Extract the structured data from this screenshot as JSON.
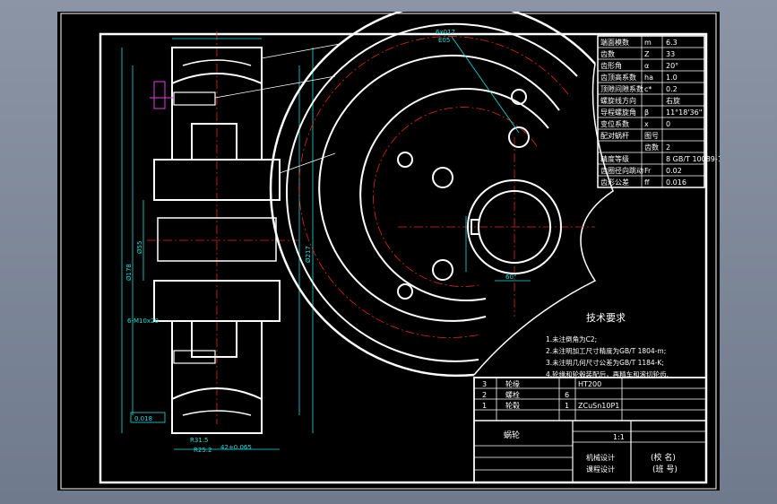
{
  "drawing": {
    "title_label": "蜗轮",
    "scale_value": "1:1",
    "tech_req": {
      "heading": "技术要求",
      "items": [
        "1.未注倒角为C2;",
        "2.未注明加工尺寸精度为GB/T 1804-m;",
        "3.未注明几何尺寸公差为GB/T 1184-K;",
        "4.轮缘和轮毂装配后，再精车和滚切轮齿."
      ]
    },
    "params": [
      {
        "name": "端面模数",
        "sym": "m",
        "val": "6.3"
      },
      {
        "name": "齿数",
        "sym": "Z",
        "val": "33"
      },
      {
        "name": "齿形角",
        "sym": "α",
        "val": "20°"
      },
      {
        "name": "齿顶高系数",
        "sym": "ha",
        "val": "1.0"
      },
      {
        "name": "顶隙间隙系数",
        "sym": "c*",
        "val": "0.2"
      },
      {
        "name": "螺旋线方向",
        "sym": "",
        "val": "右旋"
      },
      {
        "name": "导程螺旋角",
        "sym": "β",
        "val": "11°18'36\""
      },
      {
        "name": "变位系数",
        "sym": "x",
        "val": "0"
      },
      {
        "name": "配对蜗杆",
        "sym": "图号",
        "val": ""
      },
      {
        "name": "",
        "sym": "齿数",
        "val": "2"
      },
      {
        "name": "精度等级",
        "sym": "",
        "val": "8 GB/T 10089-1988"
      },
      {
        "name": "齿圈径向跳动",
        "sym": "Fr",
        "val": "0.02"
      },
      {
        "name": "齿形公差",
        "sym": "ff",
        "val": "0.016"
      }
    ],
    "bom": [
      {
        "no": "3",
        "name": "轮缘",
        "qty": "",
        "mat": "ZCuSn10P1"
      },
      {
        "no": "2",
        "name": "螺栓",
        "qty": "6",
        "mat": ""
      },
      {
        "no": "1",
        "name": "轮毂",
        "qty": "1",
        "mat": "HT200"
      }
    ],
    "title_block": {
      "designer": "机械设计",
      "course": "课程设计",
      "school_name": "(校 名)",
      "class_no": "(班 号)"
    },
    "dims": {
      "keyway": "6x017",
      "tol": "E05",
      "d1": "Ø217",
      "d2": "Ø178",
      "d3": "Ø55",
      "bolts": "6-M10x20",
      "hub_w": "42±0.065",
      "r1": "R31.5",
      "r2": "R25.2",
      "flat": "0.018",
      "angle": "60°"
    }
  }
}
